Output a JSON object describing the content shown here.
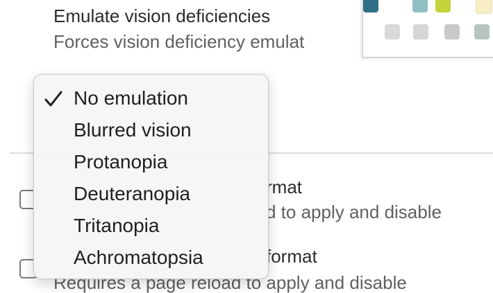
{
  "section": {
    "title": "Emulate vision deficiencies",
    "description": "Forces vision deficiency emulat"
  },
  "palette": {
    "swatches": [
      {
        "color": "#2e6f86"
      },
      {
        "color": "#8fbfc2"
      },
      {
        "color": "#c3d33c"
      },
      {
        "color": "#f7eec6"
      },
      {
        "color": "#d9d9d9"
      },
      {
        "color": "#d6d6d6"
      },
      {
        "color": "#c9c9c9"
      },
      {
        "color": "#b8c4c0"
      }
    ]
  },
  "dropdown": {
    "selected": "No emulation",
    "check_icon": "checkmark-icon",
    "items": [
      {
        "label": "No emulation"
      },
      {
        "label": "Blurred vision"
      },
      {
        "label": "Protanopia"
      },
      {
        "label": "Deuteranopia"
      },
      {
        "label": "Tritanopia"
      },
      {
        "label": "Achromatopsia"
      }
    ]
  },
  "options": [
    {
      "label": "rmat",
      "description": "d to apply and disable"
    },
    {
      "label": "format",
      "description": "Requires a page reload to apply and disable"
    }
  ],
  "colors": {
    "menu_background": "#f6f6f6",
    "divider": "#dedede",
    "secondary_text": "#606060"
  }
}
